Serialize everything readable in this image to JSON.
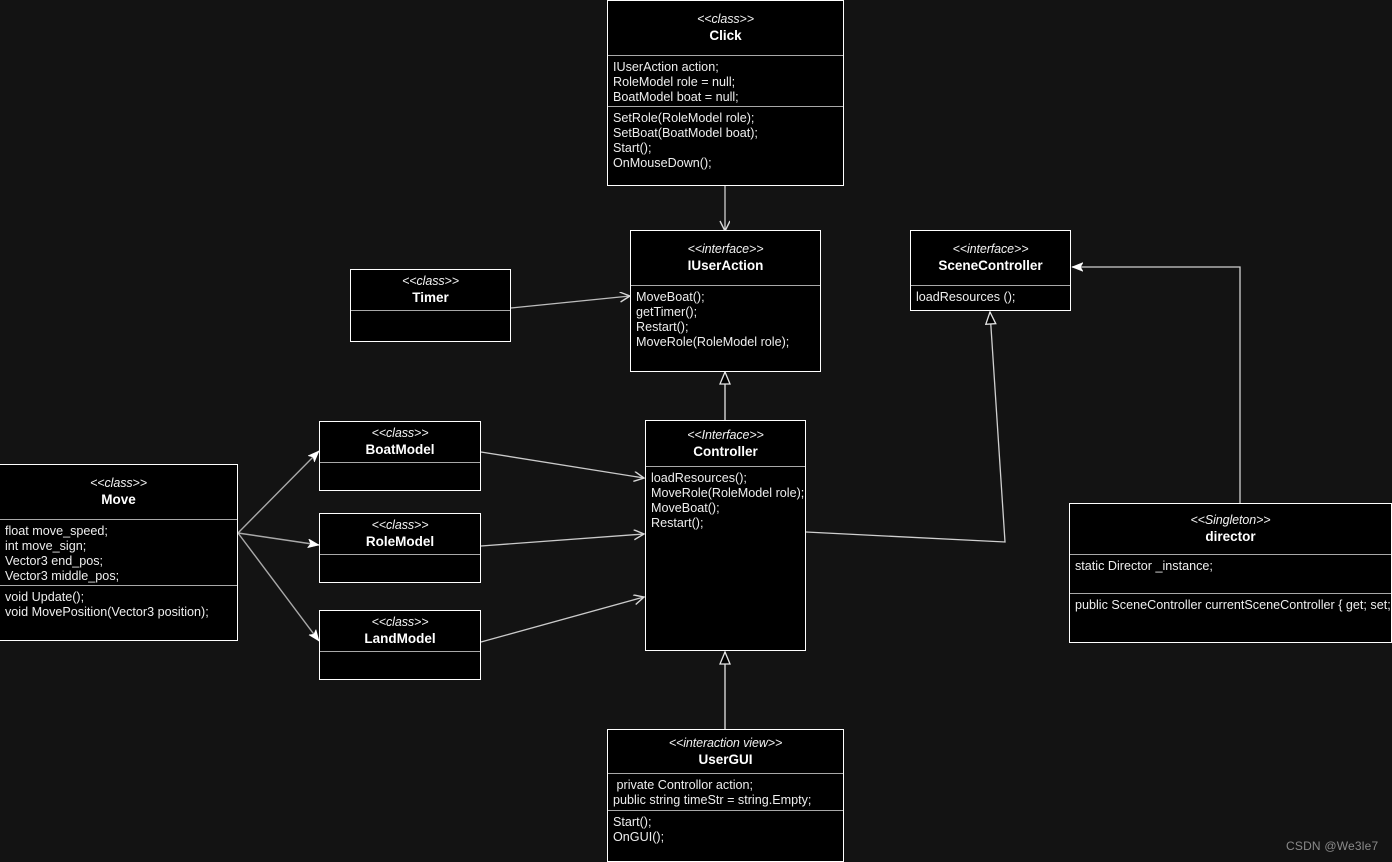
{
  "diagram": {
    "title": "UML class diagram",
    "background_color": "#131313",
    "node_fill": "#000000",
    "node_border": "#ffffff",
    "edge_color": "#cccccc",
    "text_color": "#ffffff"
  },
  "nodes": {
    "click": {
      "stereotype": "<<class>>",
      "name": "Click",
      "attributes": "IUserAction action;\nRoleModel role = null;\nBoatModel boat = null;",
      "operations": "SetRole(RoleModel role);\nSetBoat(BoatModel boat);\nStart();\nOnMouseDown();"
    },
    "iuseraction": {
      "stereotype": "<<interface>>",
      "name": "IUserAction",
      "operations": "MoveBoat();\ngetTimer();\nRestart();\nMoveRole(RoleModel role);"
    },
    "scenecontroller": {
      "stereotype": "<<interface>>",
      "name": "SceneController",
      "operations": "loadResources ();"
    },
    "timer": {
      "stereotype": "<<class>>",
      "name": "Timer",
      "body": ""
    },
    "boatmodel": {
      "stereotype": "<<class>>",
      "name": "BoatModel",
      "body": ""
    },
    "rolemodel": {
      "stereotype": "<<class>>",
      "name": "RoleModel",
      "body": ""
    },
    "landmodel": {
      "stereotype": "<<class>>",
      "name": "LandModel",
      "body": ""
    },
    "move": {
      "stereotype": "<<class>>",
      "name": "Move",
      "attributes": "float move_speed;\nint move_sign;\nVector3 end_pos;\nVector3 middle_pos;",
      "operations": "void Update();\nvoid MovePosition(Vector3 position);"
    },
    "controller": {
      "stereotype": "<<Interface>>",
      "name": "Controller",
      "operations": "loadResources();\nMoveRole(RoleModel role);\nMoveBoat();\nRestart();"
    },
    "director": {
      "stereotype": "<<Singleton>>",
      "name": "director",
      "attributes": "static Director _instance;",
      "operations": "public SceneController currentSceneController { get; set; }"
    },
    "usergui": {
      "stereotype": "<<interaction view>>",
      "name": "UserGUI",
      "attributes": " private Controllor action;\npublic string timeStr = string.Empty;",
      "operations": "Start();\nOnGUI();"
    }
  },
  "edges": [
    {
      "name": "click-to-iuseraction",
      "type": "association-open-arrow"
    },
    {
      "name": "timer-to-iuseraction",
      "type": "association-open-arrow"
    },
    {
      "name": "controller-to-iuseraction",
      "type": "generalization-hollow-triangle"
    },
    {
      "name": "usergui-to-controller",
      "type": "generalization-hollow-triangle"
    },
    {
      "name": "controller-to-scenecontroller",
      "type": "realization-hollow-triangle"
    },
    {
      "name": "director-to-scenecontroller",
      "type": "association-solid-arrow"
    },
    {
      "name": "move-to-boatmodel",
      "type": "association-solid-arrow"
    },
    {
      "name": "move-to-rolemodel",
      "type": "association-solid-arrow"
    },
    {
      "name": "move-to-landmodel",
      "type": "association-solid-arrow"
    },
    {
      "name": "boatmodel-to-controller",
      "type": "association-open-arrow"
    },
    {
      "name": "rolemodel-to-controller",
      "type": "association-open-arrow"
    },
    {
      "name": "landmodel-to-controller",
      "type": "association-open-arrow"
    }
  ],
  "watermark": {
    "text": "CSDN @We3le7"
  }
}
